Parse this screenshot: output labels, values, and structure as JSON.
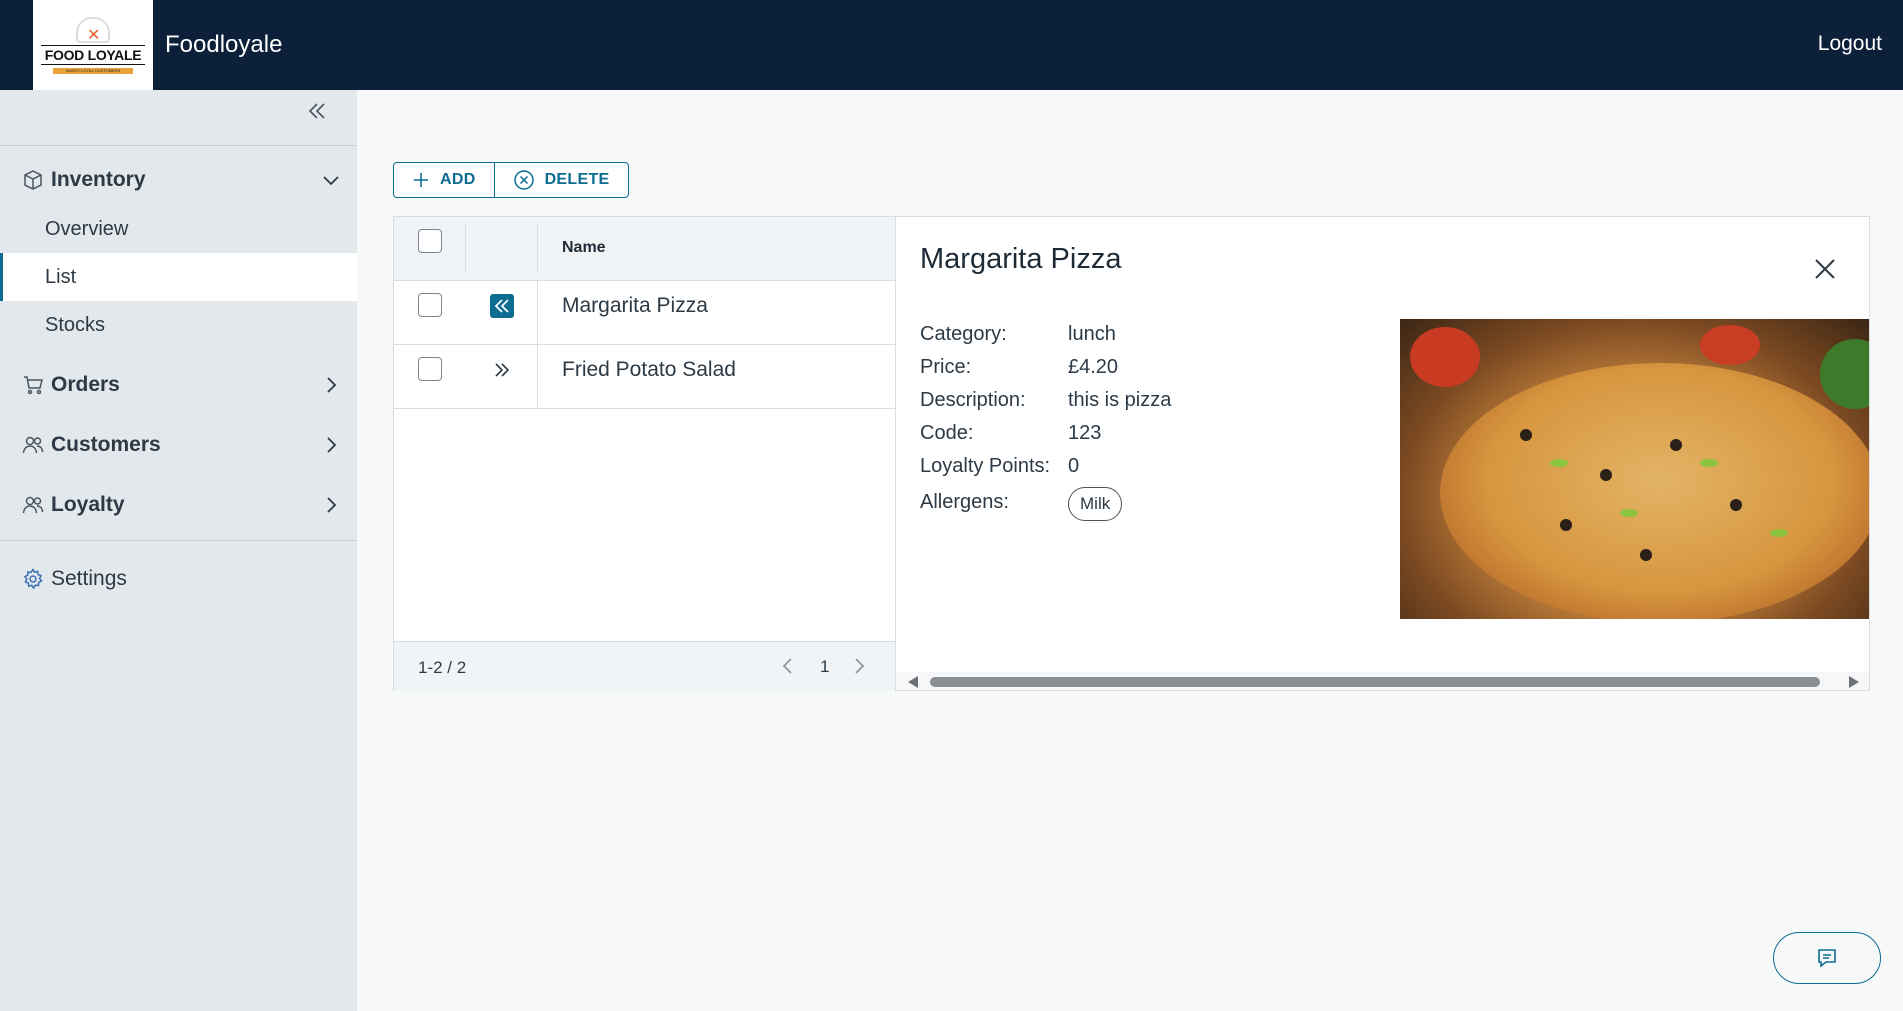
{
  "header": {
    "app_title": "Foodloyale",
    "logo_text": "FOOD LOYALE",
    "logo_tagline": "INVEST LOYAL CUSTOMERS",
    "logout_label": "Logout"
  },
  "sidebar": {
    "inventory": {
      "label": "Inventory",
      "children": [
        "Overview",
        "List",
        "Stocks"
      ],
      "active_child": "List"
    },
    "orders_label": "Orders",
    "customers_label": "Customers",
    "loyalty_label": "Loyalty",
    "settings_label": "Settings"
  },
  "toolbar": {
    "add_label": "ADD",
    "delete_label": "DELETE"
  },
  "grid": {
    "columns": [
      "Name"
    ],
    "rows": [
      {
        "name": "Margarita Pizza",
        "expanded": true
      },
      {
        "name": "Fried Potato Salad",
        "expanded": false
      }
    ],
    "footer": {
      "count": "1-2 / 2",
      "page": "1"
    }
  },
  "detail": {
    "title": "Margarita Pizza",
    "fields": {
      "category": {
        "label": "Category:",
        "value": "lunch"
      },
      "price": {
        "label": "Price:",
        "value": "£4.20"
      },
      "description": {
        "label": "Description:",
        "value": "this is pizza"
      },
      "code": {
        "label": "Code:",
        "value": "123"
      },
      "loyalty_points": {
        "label": "Loyalty Points:",
        "value": "0"
      },
      "allergens": {
        "label": "Allergens:",
        "chips": [
          "Milk"
        ]
      }
    }
  },
  "colors": {
    "header_bg": "#0c2039",
    "accent": "#0c6c92",
    "sidebar_bg": "#e2e8ec"
  }
}
